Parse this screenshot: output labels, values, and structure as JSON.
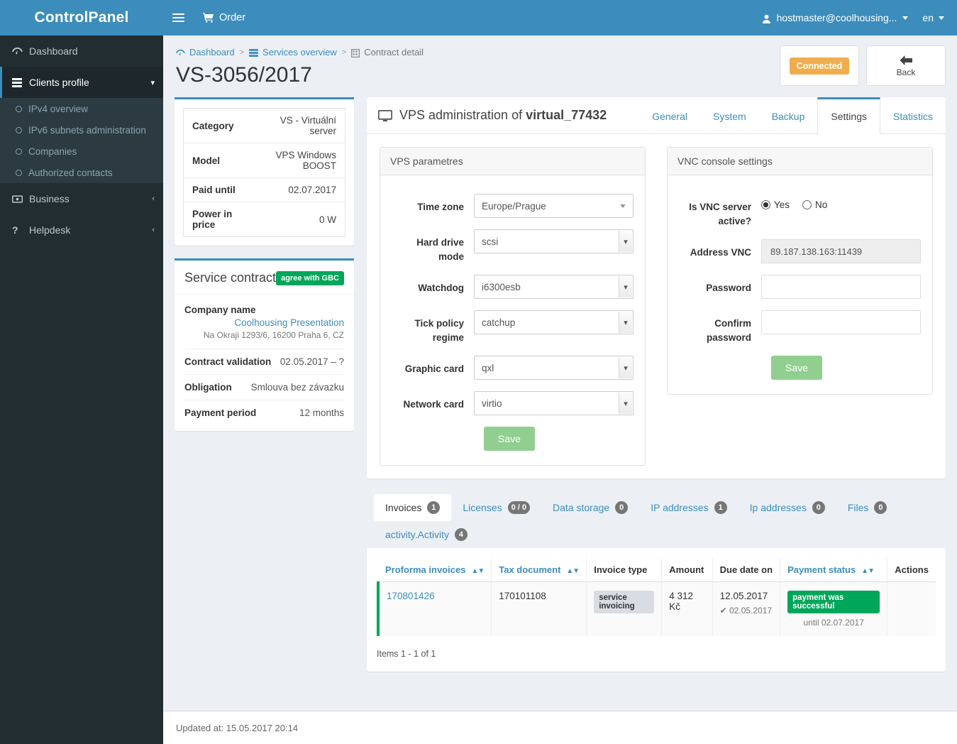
{
  "brand": {
    "title": "ControlPanel"
  },
  "topbar": {
    "order_label": "Order",
    "user_label": "hostmaster@coolhousing...",
    "lang_label": "en"
  },
  "sidebar": {
    "items": [
      {
        "label": "Dashboard",
        "icon": "dashboard-icon"
      },
      {
        "label": "Clients profile",
        "icon": "clients-icon",
        "active": true
      },
      {
        "label": "Business",
        "icon": "business-icon"
      },
      {
        "label": "Helpdesk",
        "icon": "helpdesk-icon"
      }
    ],
    "sub_items": [
      {
        "label": "IPv4 overview"
      },
      {
        "label": "IPv6 subnets administration"
      },
      {
        "label": "Companies"
      },
      {
        "label": "Authorized contacts"
      }
    ]
  },
  "breadcrumb": [
    {
      "label": "Dashboard"
    },
    {
      "label": "Services overview"
    },
    {
      "label": "Contract detail"
    }
  ],
  "page": {
    "title": "VS-3056/2017",
    "connected_label": "Connected",
    "back_label": "Back"
  },
  "info_card": {
    "rows": [
      {
        "key": "Category",
        "value": "VS - Virtuální server"
      },
      {
        "key": "Model",
        "value": "VPS Windows BOOST"
      },
      {
        "key": "Paid until",
        "value": "02.07.2017"
      },
      {
        "key": "Power in price",
        "value": "0 W"
      }
    ]
  },
  "service_contract": {
    "title": "Service contract",
    "badge": "agree with GBC",
    "company_label": "Company name",
    "company_name": "Coolhousing Presentation",
    "company_address": "Na Okraji 1293/6, 16200 Praha 6, CZ",
    "rows": [
      {
        "key": "Contract validation",
        "value": "02.05.2017 – ?"
      },
      {
        "key": "Obligation",
        "value": "Smlouva bez závazku"
      },
      {
        "key": "Payment period",
        "value": "12 months"
      }
    ]
  },
  "vps": {
    "title_prefix": "VPS administration of ",
    "title_name": "virtual_77432",
    "tabs": [
      {
        "label": "General",
        "active": false
      },
      {
        "label": "System",
        "active": false
      },
      {
        "label": "Backup",
        "active": false
      },
      {
        "label": "Settings",
        "active": true
      },
      {
        "label": "Statistics",
        "active": false
      }
    ],
    "parameters_panel": {
      "title": "VPS parametres",
      "fields": [
        {
          "label": "Time zone",
          "value": "Europe/Prague",
          "type": "custom-select"
        },
        {
          "label": "Hard drive mode",
          "value": "scsi",
          "type": "native-select"
        },
        {
          "label": "Watchdog",
          "value": "i6300esb",
          "type": "native-select"
        },
        {
          "label": "Tick policy regime",
          "value": "catchup",
          "type": "native-select"
        },
        {
          "label": "Graphic card",
          "value": "qxl",
          "type": "native-select"
        },
        {
          "label": "Network card",
          "value": "virtio",
          "type": "native-select"
        }
      ],
      "save_label": "Save"
    },
    "vnc_panel": {
      "title": "VNC console settings",
      "active_label": "Is VNC server active?",
      "yes_label": "Yes",
      "no_label": "No",
      "selected": "Yes",
      "address_label": "Address VNC",
      "address_value": "89.187.138.163:11439",
      "password_label": "Password",
      "password_value": "",
      "confirm_label": "Confirm password",
      "confirm_value": "",
      "save_label": "Save"
    }
  },
  "bottom_tabs": [
    {
      "label": "Invoices",
      "count": "1",
      "active": true
    },
    {
      "label": "Licenses",
      "count": "0 / 0",
      "active": false
    },
    {
      "label": "Data storage",
      "count": "0",
      "active": false
    },
    {
      "label": "IP addresses",
      "count": "1",
      "active": false
    },
    {
      "label": "Ip addresses",
      "count": "0",
      "active": false
    },
    {
      "label": "Files",
      "count": "0",
      "active": false
    },
    {
      "label": "activity.Activity",
      "count": "4",
      "active": false
    }
  ],
  "invoices_table": {
    "headers": [
      {
        "label": "Proforma invoices",
        "sortable": true,
        "link": true
      },
      {
        "label": "Tax document",
        "sortable": true,
        "link": true
      },
      {
        "label": "Invoice type",
        "sortable": false,
        "link": false
      },
      {
        "label": "Amount",
        "sortable": false,
        "link": false
      },
      {
        "label": "Due date on",
        "sortable": false,
        "link": false
      },
      {
        "label": "Payment status",
        "sortable": true,
        "link": true
      },
      {
        "label": "Actions",
        "sortable": false,
        "link": false
      }
    ],
    "rows": [
      {
        "proforma": "170801426",
        "tax_document": "170101108",
        "invoice_type": "service invoicing",
        "amount": "4 312 Kč",
        "due_date": "12.05.2017",
        "paid_date": "02.05.2017",
        "status": "payment was successful",
        "status_note": "until 02.07.2017",
        "actions": ""
      }
    ],
    "items_note": "Items 1 - 1 of 1"
  },
  "footer": {
    "updated_at": "Updated at: 15.05.2017 20:14"
  },
  "colors": {
    "brand_blue": "#3c8dbc",
    "sidebar_dark": "#222d32",
    "sidebar_sub": "#2c3b41",
    "content_bg": "#ecf0f5",
    "green": "#00a65a",
    "save_green": "#90cf90",
    "orange": "#f0ad4e",
    "link_blue": "#3c8dbc"
  }
}
